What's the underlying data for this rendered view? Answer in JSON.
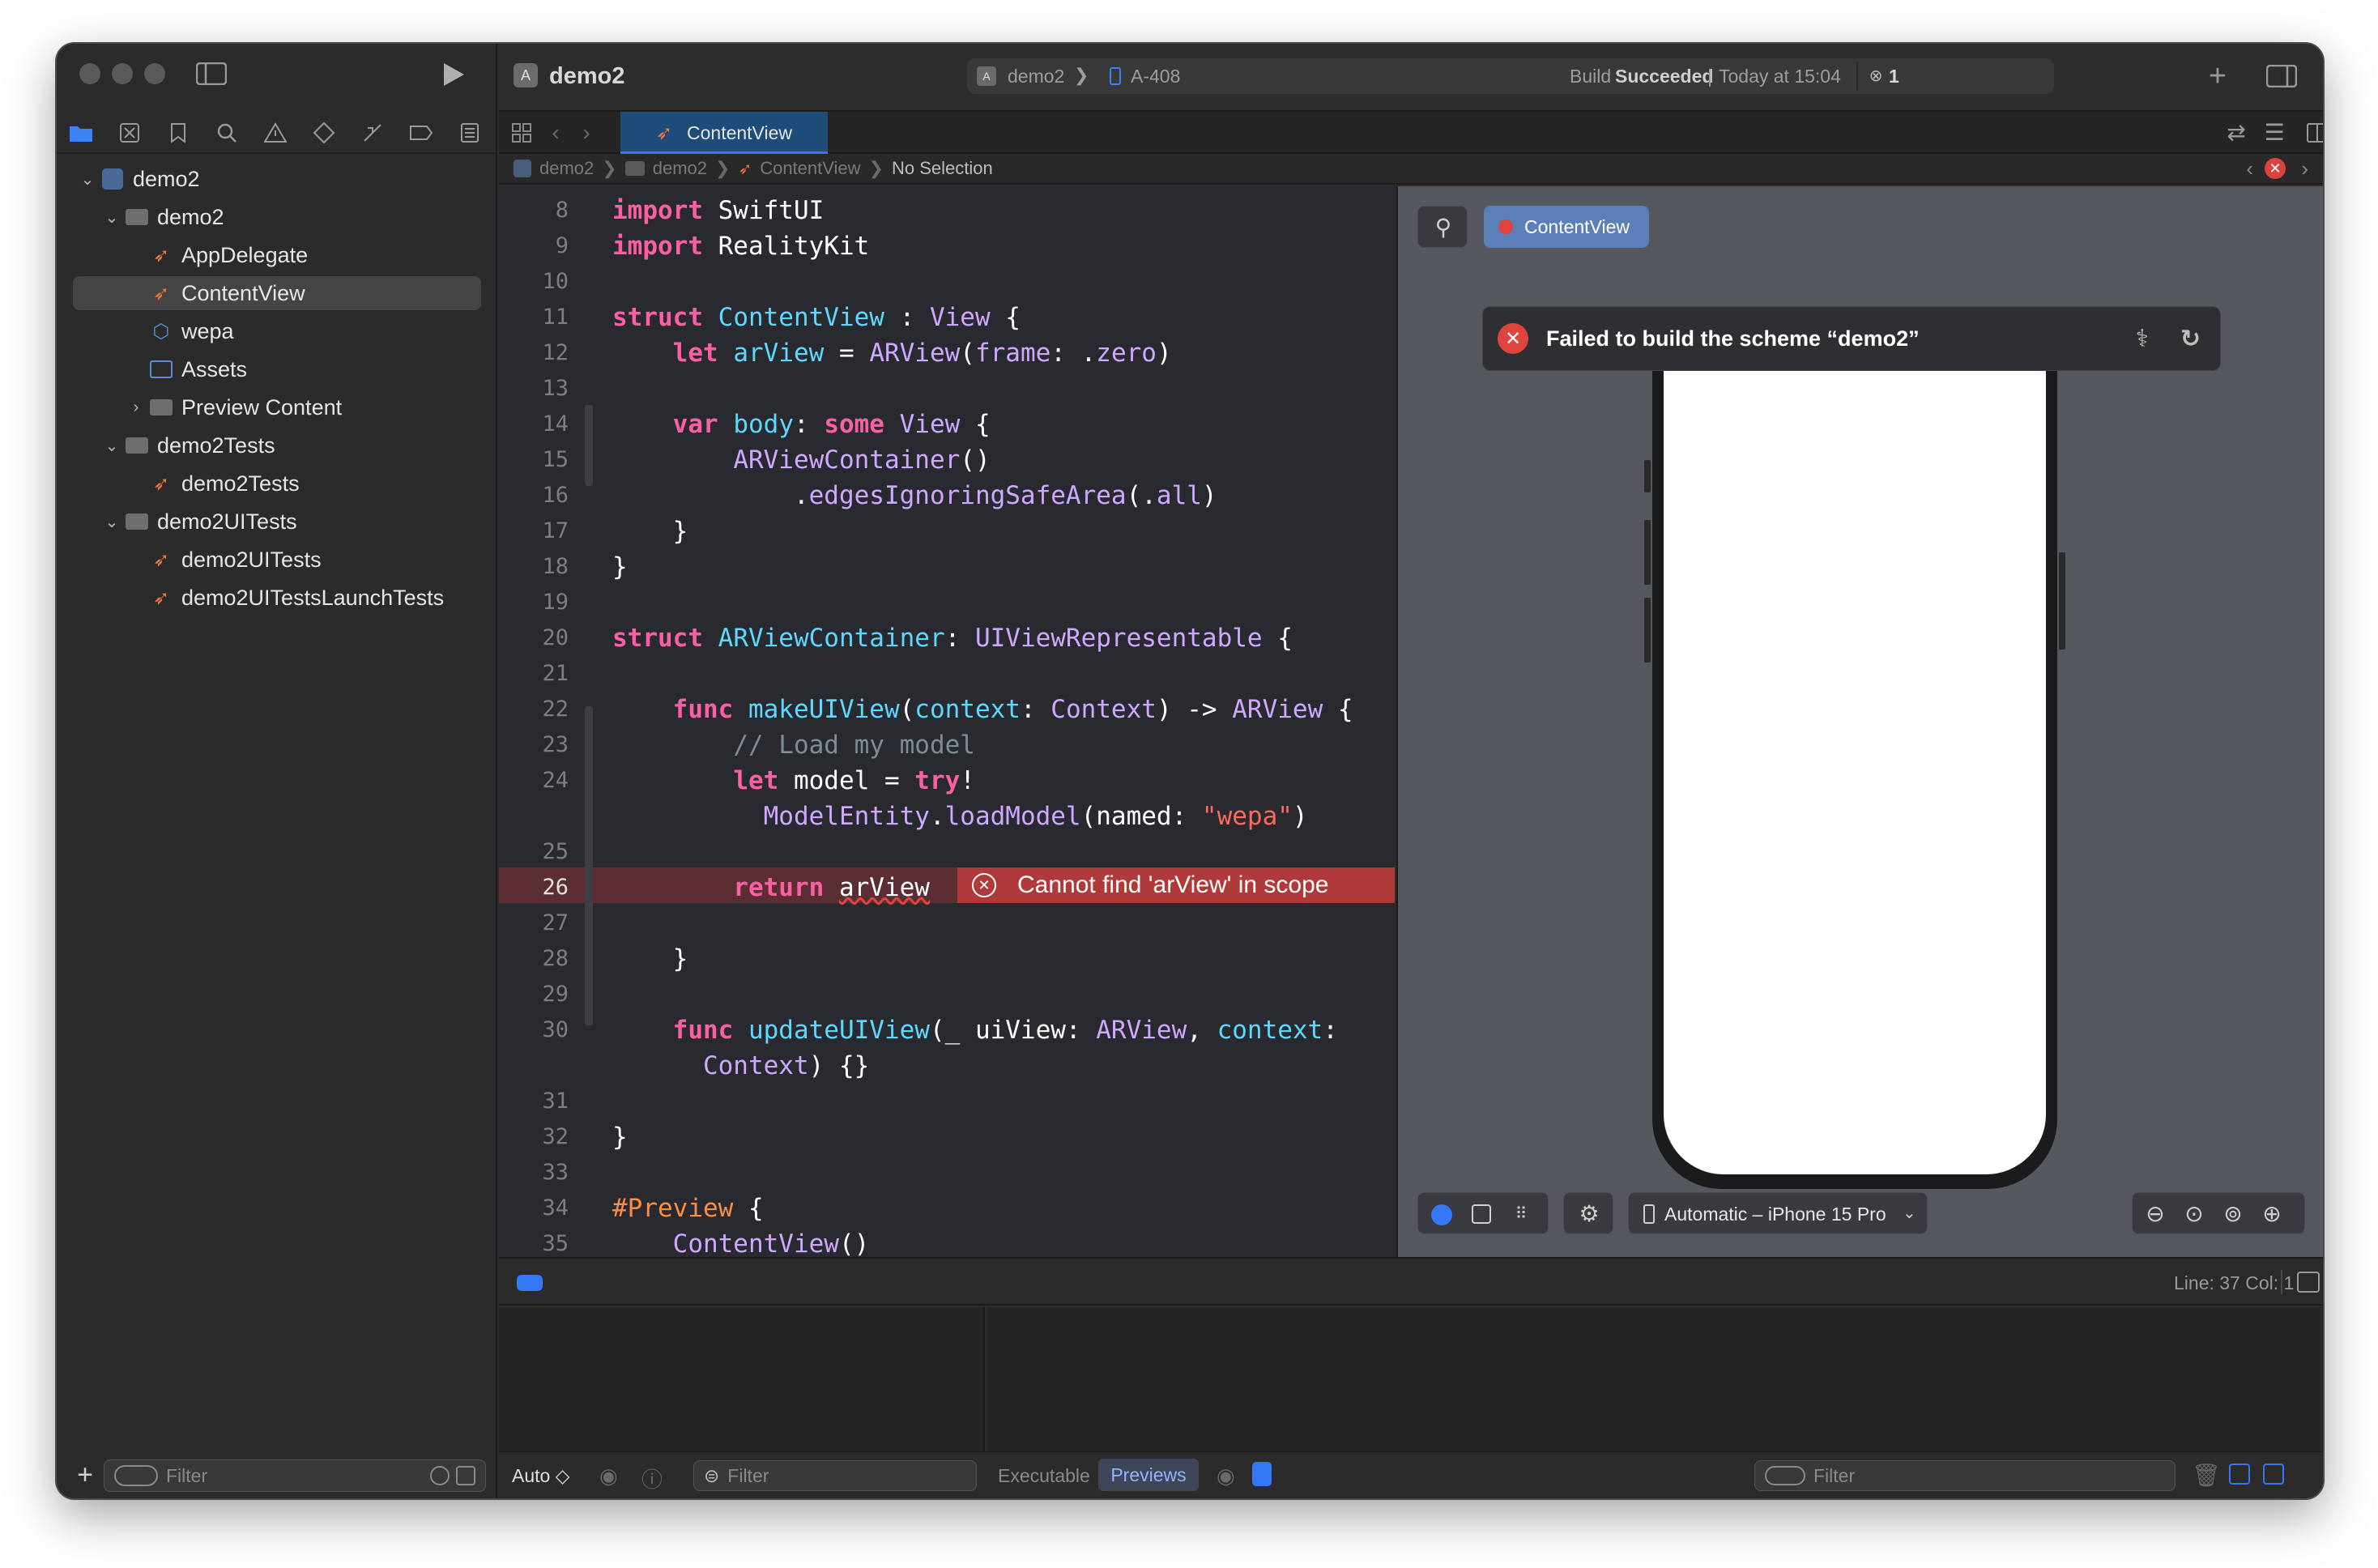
{
  "window": {
    "project_title": "demo2"
  },
  "toolbar": {
    "scheme": "demo2",
    "device": "A-408",
    "build_status_prefix": "Build",
    "build_status_word": "Succeeded",
    "build_time": "Today at 15:04",
    "error_count": "1"
  },
  "sidebar": {
    "tree": [
      {
        "label": "demo2",
        "depth": 0,
        "icon": "project-icon",
        "expanded": true
      },
      {
        "label": "demo2",
        "depth": 1,
        "icon": "folder-icon",
        "expanded": true
      },
      {
        "label": "AppDelegate",
        "depth": 2,
        "icon": "swift-file-icon"
      },
      {
        "label": "ContentView",
        "depth": 2,
        "icon": "swift-file-icon",
        "selected": true
      },
      {
        "label": "wepa",
        "depth": 2,
        "icon": "cube-icon"
      },
      {
        "label": "Assets",
        "depth": 2,
        "icon": "asset-catalog-icon"
      },
      {
        "label": "Preview Content",
        "depth": 2,
        "icon": "folder-icon",
        "expanded": false
      },
      {
        "label": "demo2Tests",
        "depth": 1,
        "icon": "folder-icon",
        "expanded": true
      },
      {
        "label": "demo2Tests",
        "depth": 2,
        "icon": "swift-file-icon"
      },
      {
        "label": "demo2UITests",
        "depth": 1,
        "icon": "folder-icon",
        "expanded": true
      },
      {
        "label": "demo2UITests",
        "depth": 2,
        "icon": "swift-file-icon"
      },
      {
        "label": "demo2UITestsLaunchTests",
        "depth": 2,
        "icon": "swift-file-icon"
      }
    ],
    "filter_placeholder": "Filter"
  },
  "editor": {
    "tab_label": "ContentView",
    "breadcrumb": [
      "demo2",
      "demo2",
      "ContentView",
      "No Selection"
    ],
    "error_message": "Cannot find 'arView' in scope",
    "line_numbers": [
      "8",
      "9",
      "10",
      "11",
      "12",
      "13",
      "14",
      "15",
      "16",
      "17",
      "18",
      "19",
      "20",
      "21",
      "22",
      "23",
      "24",
      "",
      "25",
      "26",
      "27",
      "28",
      "29",
      "30",
      "",
      "31",
      "32",
      "33",
      "34",
      "35"
    ]
  },
  "canvas": {
    "preview_tab": "ContentView",
    "error_banner": "Failed to build the scheme “demo2”",
    "device_selector": "Automatic – iPhone 15 Pro"
  },
  "status": {
    "cursor_position": "Line: 37  Col: 1"
  },
  "debug": {
    "auto_label": "Auto ◇",
    "filter_placeholder": "Filter",
    "tab_executable": "Executable",
    "tab_previews": "Previews",
    "right_filter_placeholder": "Filter"
  },
  "colors": {
    "keyword": "#fc5fa3",
    "type": "#5dd8ff",
    "error": "#e0443e",
    "accent": "#3478f6"
  }
}
